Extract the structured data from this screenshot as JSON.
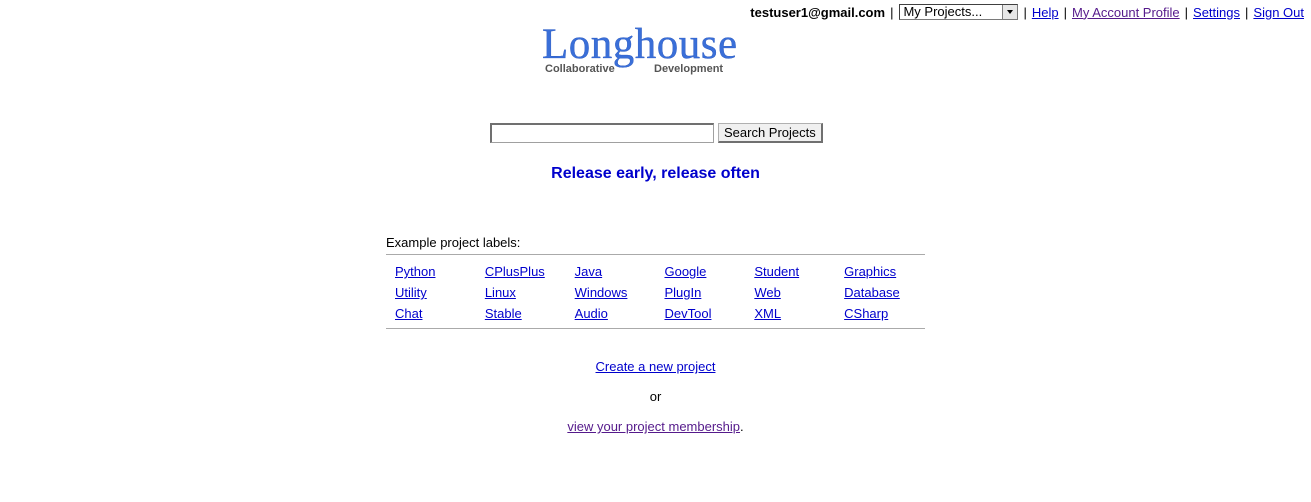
{
  "userbar": {
    "email": "testuser1@gmail.com",
    "projects_select": "My Projects...",
    "separator": "|",
    "help": "Help",
    "account_profile": "My Account Profile",
    "settings": "Settings",
    "sign_out": "Sign Out"
  },
  "logo": {
    "word": "Longhouse",
    "tag_left": "Collaborative",
    "tag_right": "Development"
  },
  "search": {
    "value": "",
    "button": "Search Projects"
  },
  "tagline": "Release early, release often",
  "labels": {
    "heading": "Example project labels:",
    "rows": [
      [
        "Python",
        "CPlusPlus",
        "Java",
        "Google",
        "Student",
        "Graphics"
      ],
      [
        "Utility",
        "Linux",
        "Windows",
        "PlugIn",
        "Web",
        "Database"
      ],
      [
        "Chat",
        "Stable",
        "Audio",
        "DevTool",
        "XML",
        "CSharp"
      ]
    ]
  },
  "create_project": "Create a new project",
  "or": "or",
  "membership_link": "view your project membership",
  "membership_suffix": ".",
  "colors": {
    "link": "#0000cc",
    "visited": "#551a8b",
    "logo": "#3a6fd8"
  }
}
